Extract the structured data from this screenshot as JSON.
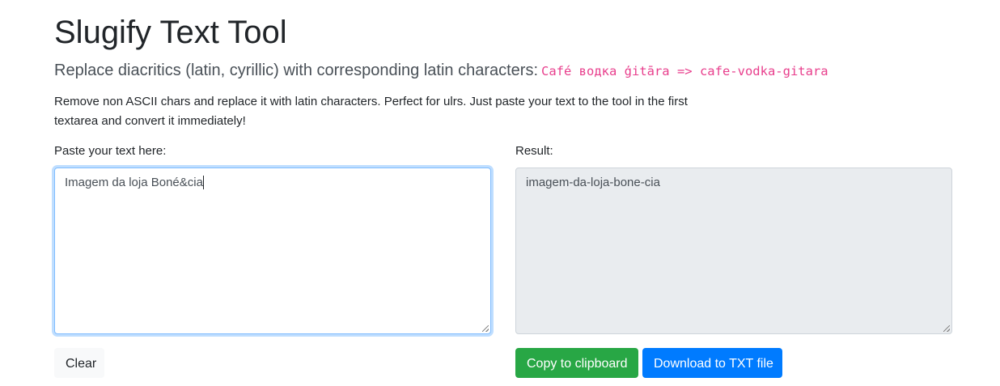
{
  "header": {
    "title": "Slugify Text Tool",
    "lead_text": "Replace diacritics (latin, cyrillic) with corresponding latin characters:",
    "lead_example": "Café водка ģitāra => cafe-vodka-gitara",
    "description": "Remove non ASCII chars and replace it with latin characters. Perfect for ulrs. Just paste your text to the tool in the first textarea and convert it immediately!"
  },
  "input": {
    "label": "Paste your text here:",
    "value": "Imagem da loja Boné&cia"
  },
  "output": {
    "label": "Result:",
    "value": "imagem-da-loja-bone-cia"
  },
  "buttons": {
    "clear": "Clear",
    "copy": "Copy to clipboard",
    "download": "Download to TXT file"
  },
  "colors": {
    "primary": "#007bff",
    "success": "#28a745",
    "code": "#e83e8c",
    "readonly_bg": "#e9ecef"
  }
}
